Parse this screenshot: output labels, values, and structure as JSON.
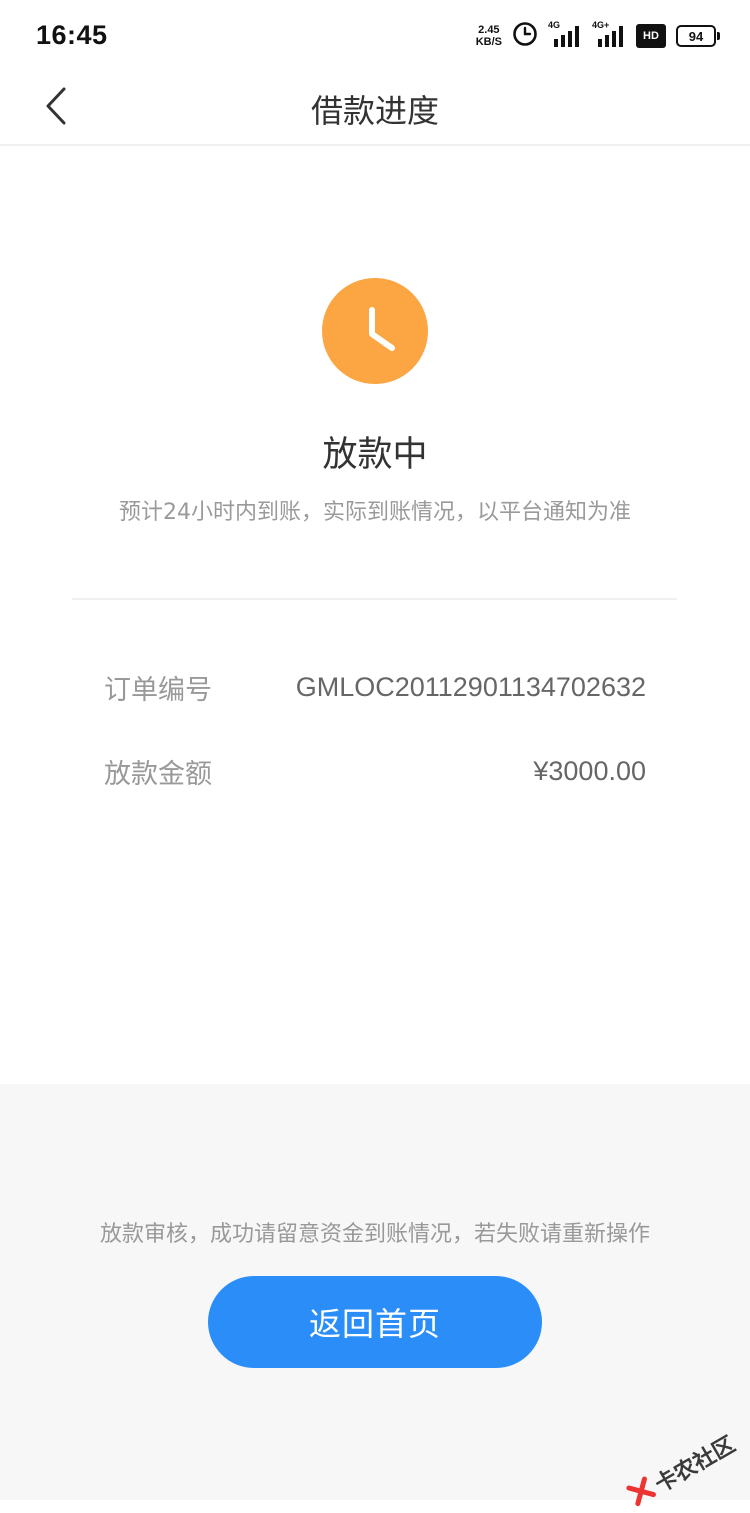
{
  "status_bar": {
    "time": "16:45",
    "net_speed_value": "2.45",
    "net_speed_unit": "KB/S",
    "signal1_label": "4G",
    "signal2_label": "4G+",
    "hd_label": "HD",
    "battery": "94",
    "icons": [
      "alarm-icon",
      "signal-icon",
      "signal-icon",
      "hd-icon",
      "battery-icon"
    ]
  },
  "nav": {
    "title": "借款进度",
    "back_icon": "chevron-left-icon"
  },
  "status": {
    "icon": "clock-icon",
    "icon_color": "#fba543",
    "title": "放款中",
    "subtitle": "预计24小时内到账，实际到账情况，以平台通知为准"
  },
  "details": {
    "order_label": "订单编号",
    "order_value": "GMLOC20112901134702632",
    "amount_label": "放款金额",
    "amount_value": "¥3000.00"
  },
  "footer": {
    "note": "放款审核，成功请留意资金到账情况，若失败请重新操作",
    "button_label": "返回首页",
    "button_color": "#2b8ef8"
  },
  "watermark": {
    "text": "卡农社区"
  }
}
